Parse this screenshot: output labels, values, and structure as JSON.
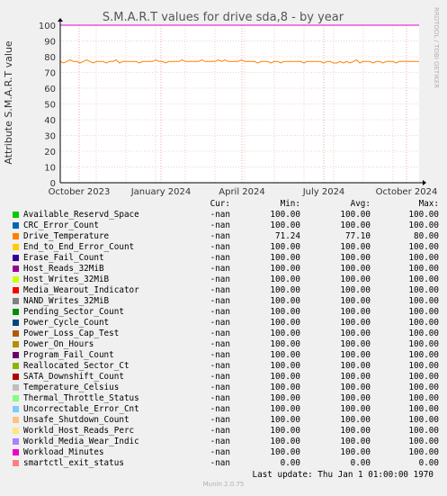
{
  "chart_data": {
    "type": "line",
    "title": "S.M.A.R.T values for drive sda,8 - by year",
    "ylabel": "Attribute S.M.A.R.T value",
    "xlabel": "",
    "ylim": [
      0,
      100
    ],
    "yticks": [
      0,
      10,
      20,
      30,
      40,
      50,
      60,
      70,
      80,
      90,
      100
    ],
    "x_ticks": [
      "October 2023",
      "January 2024",
      "April 2024",
      "July 2024",
      "October 2024"
    ],
    "grid": true,
    "series": [
      {
        "name": "Available_Reservd_Space",
        "values": [
          100,
          100
        ],
        "color": "#00cc00"
      },
      {
        "name": "CRC_Error_Count",
        "values": [
          100,
          100
        ],
        "color": "#0066b3"
      },
      {
        "name": "Drive_Temperature",
        "color": "#ff8000",
        "values": [
          77,
          76,
          77,
          78,
          77,
          77,
          76,
          77,
          78,
          77,
          76,
          77,
          77,
          77,
          76,
          77,
          77,
          78,
          76,
          77,
          77,
          77,
          77,
          77,
          76,
          77,
          77,
          77,
          77,
          78,
          77,
          77,
          76,
          77,
          77,
          77,
          77,
          78,
          77,
          77,
          77,
          77,
          77,
          78,
          77,
          77,
          77,
          77,
          78,
          77,
          78,
          77,
          77,
          77,
          77,
          78,
          77,
          77,
          77,
          77,
          76,
          77,
          77,
          77,
          76,
          77,
          77,
          76,
          77,
          77,
          77,
          77,
          77,
          77,
          76,
          77,
          77,
          77,
          77,
          77,
          76,
          77,
          77,
          76,
          76,
          77,
          76,
          77,
          76,
          77,
          78,
          76,
          77,
          77,
          77,
          76,
          77,
          77,
          76,
          77,
          77,
          77,
          76,
          77,
          77,
          77,
          77,
          77,
          77,
          77
        ]
      },
      {
        "name": "End_to_End_Error_Count",
        "values": [
          100,
          100
        ],
        "color": "#ffcc00"
      },
      {
        "name": "Erase_Fail_Count",
        "values": [
          100,
          100
        ],
        "color": "#330099"
      },
      {
        "name": "Host_Reads_32MiB",
        "values": [
          100,
          100
        ],
        "color": "#990099"
      },
      {
        "name": "Host_Writes_32MiB",
        "values": [
          100,
          100
        ],
        "color": "#ccff00"
      },
      {
        "name": "Media_Wearout_Indicator",
        "values": [
          100,
          100
        ],
        "color": "#ff0000"
      },
      {
        "name": "NAND_Writes_32MiB",
        "values": [
          100,
          100
        ],
        "color": "#808080"
      },
      {
        "name": "Pending_Sector_Count",
        "values": [
          100,
          100
        ],
        "color": "#008f00"
      },
      {
        "name": "Power_Cycle_Count",
        "values": [
          100,
          100
        ],
        "color": "#00487d"
      },
      {
        "name": "Power_Loss_Cap_Test",
        "values": [
          100,
          100
        ],
        "color": "#b35a00"
      },
      {
        "name": "Power_On_Hours",
        "values": [
          100,
          100
        ],
        "color": "#b38f00"
      },
      {
        "name": "Program_Fail_Count",
        "values": [
          100,
          100
        ],
        "color": "#6b006b"
      },
      {
        "name": "Reallocated_Sector_Ct",
        "values": [
          100,
          100
        ],
        "color": "#8fb300"
      },
      {
        "name": "SATA_Downshift_Count",
        "values": [
          100,
          100
        ],
        "color": "#b30000"
      },
      {
        "name": "Temperature_Celsius",
        "values": [
          100,
          100
        ],
        "color": "#bebebe"
      },
      {
        "name": "Thermal_Throttle_Status",
        "values": [
          100,
          100
        ],
        "color": "#80ff80"
      },
      {
        "name": "Uncorrectable_Error_Cnt",
        "values": [
          100,
          100
        ],
        "color": "#80c9ff"
      },
      {
        "name": "Unsafe_Shutdown_Count",
        "values": [
          100,
          100
        ],
        "color": "#ffc080"
      },
      {
        "name": "Workld_Host_Reads_Perc",
        "values": [
          100,
          100
        ],
        "color": "#ffe680"
      },
      {
        "name": "Workld_Media_Wear_Indic",
        "values": [
          100,
          100
        ],
        "color": "#aa80ff"
      },
      {
        "name": "Workload_Minutes",
        "values": [
          100,
          100
        ],
        "color": "#ee00cc"
      },
      {
        "name": "smartctl_exit_status",
        "values": [
          0,
          0
        ],
        "color": "#ff8080"
      }
    ]
  },
  "side_label": "RRDTOOL / TOBI OETIKER",
  "legend": {
    "headers": {
      "cur": "Cur:",
      "min": "Min:",
      "avg": "Avg:",
      "max": "Max:"
    },
    "rows": [
      {
        "name": "Available_Reservd_Space",
        "color": "#00cc00",
        "cur": "-nan",
        "min": "100.00",
        "avg": "100.00",
        "max": "100.00"
      },
      {
        "name": "CRC_Error_Count",
        "color": "#0066b3",
        "cur": "-nan",
        "min": "100.00",
        "avg": "100.00",
        "max": "100.00"
      },
      {
        "name": "Drive_Temperature",
        "color": "#ff8000",
        "cur": "-nan",
        "min": "71.24",
        "avg": "77.10",
        "max": "80.00"
      },
      {
        "name": "End_to_End_Error_Count",
        "color": "#ffcc00",
        "cur": "-nan",
        "min": "100.00",
        "avg": "100.00",
        "max": "100.00"
      },
      {
        "name": "Erase_Fail_Count",
        "color": "#330099",
        "cur": "-nan",
        "min": "100.00",
        "avg": "100.00",
        "max": "100.00"
      },
      {
        "name": "Host_Reads_32MiB",
        "color": "#990099",
        "cur": "-nan",
        "min": "100.00",
        "avg": "100.00",
        "max": "100.00"
      },
      {
        "name": "Host_Writes_32MiB",
        "color": "#ccff00",
        "cur": "-nan",
        "min": "100.00",
        "avg": "100.00",
        "max": "100.00"
      },
      {
        "name": "Media_Wearout_Indicator",
        "color": "#ff0000",
        "cur": "-nan",
        "min": "100.00",
        "avg": "100.00",
        "max": "100.00"
      },
      {
        "name": "NAND_Writes_32MiB",
        "color": "#808080",
        "cur": "-nan",
        "min": "100.00",
        "avg": "100.00",
        "max": "100.00"
      },
      {
        "name": "Pending_Sector_Count",
        "color": "#008f00",
        "cur": "-nan",
        "min": "100.00",
        "avg": "100.00",
        "max": "100.00"
      },
      {
        "name": "Power_Cycle_Count",
        "color": "#00487d",
        "cur": "-nan",
        "min": "100.00",
        "avg": "100.00",
        "max": "100.00"
      },
      {
        "name": "Power_Loss_Cap_Test",
        "color": "#b35a00",
        "cur": "-nan",
        "min": "100.00",
        "avg": "100.00",
        "max": "100.00"
      },
      {
        "name": "Power_On_Hours",
        "color": "#b38f00",
        "cur": "-nan",
        "min": "100.00",
        "avg": "100.00",
        "max": "100.00"
      },
      {
        "name": "Program_Fail_Count",
        "color": "#6b006b",
        "cur": "-nan",
        "min": "100.00",
        "avg": "100.00",
        "max": "100.00"
      },
      {
        "name": "Reallocated_Sector_Ct",
        "color": "#8fb300",
        "cur": "-nan",
        "min": "100.00",
        "avg": "100.00",
        "max": "100.00"
      },
      {
        "name": "SATA_Downshift_Count",
        "color": "#b30000",
        "cur": "-nan",
        "min": "100.00",
        "avg": "100.00",
        "max": "100.00"
      },
      {
        "name": "Temperature_Celsius",
        "color": "#bebebe",
        "cur": "-nan",
        "min": "100.00",
        "avg": "100.00",
        "max": "100.00"
      },
      {
        "name": "Thermal_Throttle_Status",
        "color": "#80ff80",
        "cur": "-nan",
        "min": "100.00",
        "avg": "100.00",
        "max": "100.00"
      },
      {
        "name": "Uncorrectable_Error_Cnt",
        "color": "#80c9ff",
        "cur": "-nan",
        "min": "100.00",
        "avg": "100.00",
        "max": "100.00"
      },
      {
        "name": "Unsafe_Shutdown_Count",
        "color": "#ffc080",
        "cur": "-nan",
        "min": "100.00",
        "avg": "100.00",
        "max": "100.00"
      },
      {
        "name": "Workld_Host_Reads_Perc",
        "color": "#ffe680",
        "cur": "-nan",
        "min": "100.00",
        "avg": "100.00",
        "max": "100.00"
      },
      {
        "name": "Workld_Media_Wear_Indic",
        "color": "#aa80ff",
        "cur": "-nan",
        "min": "100.00",
        "avg": "100.00",
        "max": "100.00"
      },
      {
        "name": "Workload_Minutes",
        "color": "#ee00cc",
        "cur": "-nan",
        "min": "100.00",
        "avg": "100.00",
        "max": "100.00"
      },
      {
        "name": "smartctl_exit_status",
        "color": "#ff8080",
        "cur": "-nan",
        "min": "0.00",
        "avg": "0.00",
        "max": "0.00"
      }
    ],
    "last_update": "Last update: Thu Jan  1 01:00:00 1970"
  },
  "footer": "Munin 2.0.75"
}
